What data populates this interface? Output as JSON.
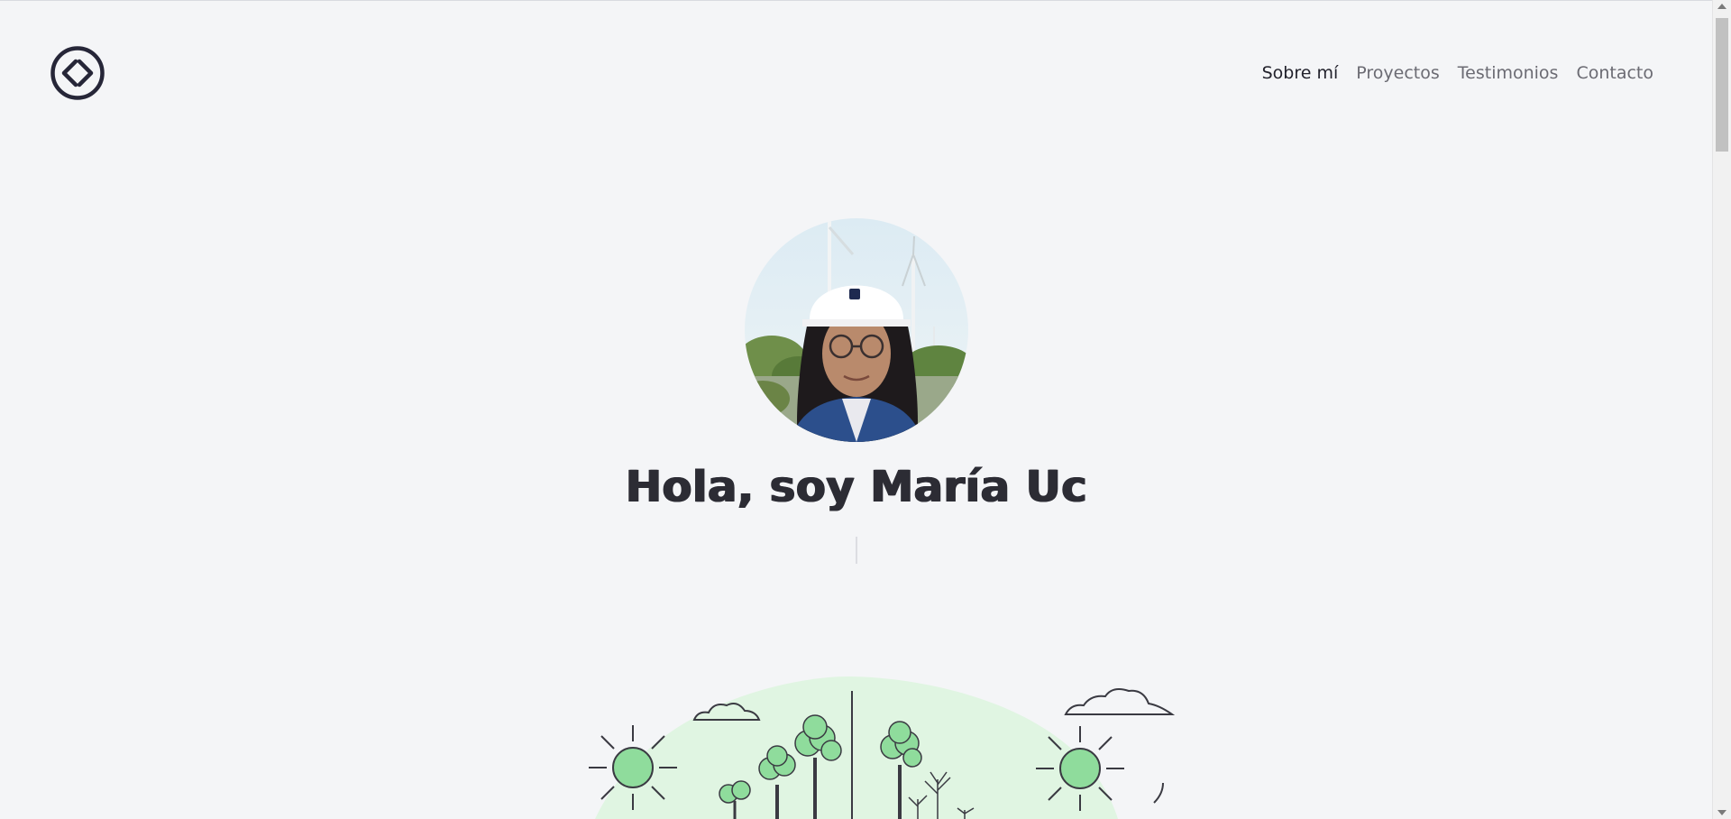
{
  "header": {
    "logo_icon": "code-brackets-icon",
    "nav": {
      "items": [
        {
          "label": "Sobre mí",
          "active": true
        },
        {
          "label": "Proyectos",
          "active": false
        },
        {
          "label": "Testimonios",
          "active": false
        },
        {
          "label": "Contacto",
          "active": false
        }
      ]
    }
  },
  "hero": {
    "title": "Hola, soy María Uc",
    "avatar_icon": "profile-photo"
  },
  "colors": {
    "background": "#f4f5f7",
    "text": "#2a2a36",
    "nav_muted": "#6b6b73",
    "accent_green": "#8fdc9c",
    "light_green": "#e0f5e2"
  }
}
